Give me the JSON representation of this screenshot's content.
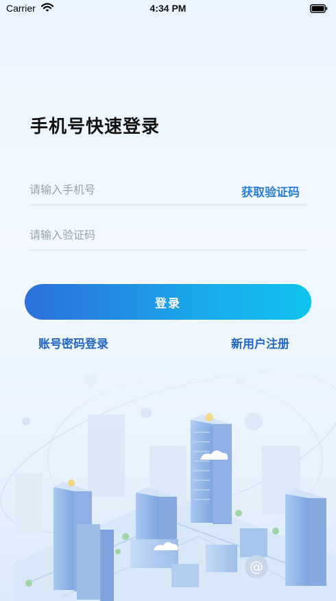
{
  "status_bar": {
    "carrier": "Carrier",
    "time": "4:34 PM"
  },
  "page": {
    "title": "手机号快速登录"
  },
  "phone_field": {
    "placeholder": "请输入手机号",
    "value": "",
    "get_code_label": "获取验证码"
  },
  "code_field": {
    "placeholder": "请输入验证码",
    "value": ""
  },
  "actions": {
    "login_label": "登录",
    "password_login_label": "账号密码登录",
    "register_label": "新用户注册"
  },
  "colors": {
    "accent": "#2a7fd8",
    "button_start": "#2d6fdc",
    "button_end": "#10c3ef",
    "link": "#2466c4"
  },
  "icons": [
    "wifi-icon",
    "battery-icon",
    "city-illustration"
  ]
}
